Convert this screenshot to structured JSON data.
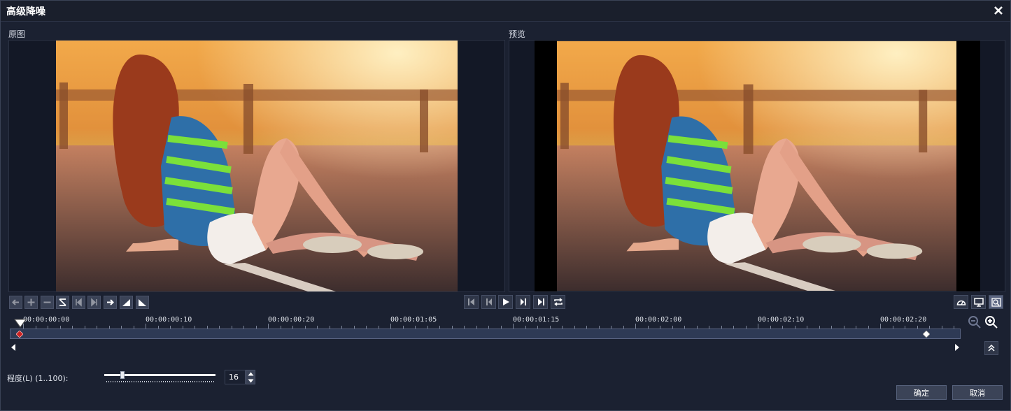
{
  "dialog": {
    "title": "高级降噪"
  },
  "panels": {
    "original_label": "原图",
    "preview_label": "预览"
  },
  "timeline": {
    "ticks": [
      "00:00:00:00",
      "00:00:00:10",
      "00:00:00:20",
      "00:00:01:05",
      "00:00:01:15",
      "00:00:02:00",
      "00:00:02:10",
      "00:00:02:20"
    ]
  },
  "strength": {
    "label": "程度(L) (1..100):",
    "value": "16",
    "min": 1,
    "max": 100
  },
  "buttons": {
    "ok": "确定",
    "cancel": "取消"
  },
  "colors": {
    "background": "#1b2131",
    "track": "#2e3a55",
    "keyframe": "#cc2222"
  }
}
